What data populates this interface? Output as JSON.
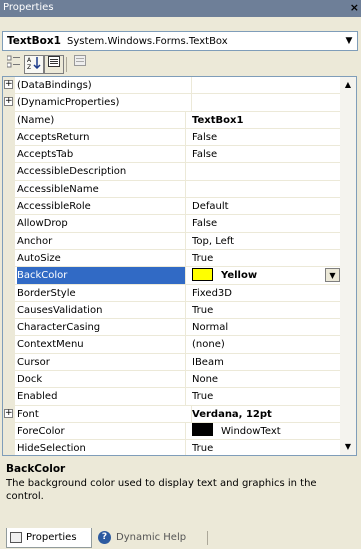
{
  "window": {
    "title": "Properties",
    "close_label": "×"
  },
  "object_selector": {
    "name": "TextBox1",
    "type": "System.Windows.Forms.TextBox"
  },
  "toolbar": {
    "categorized_icon": "categorized-icon",
    "alphabetical_icon": "alphabetical-icon",
    "properties_icon": "properties-icon",
    "property_pages_icon": "property-pages-icon"
  },
  "properties": [
    {
      "name": "(DataBindings)",
      "value": "",
      "expandable": true
    },
    {
      "name": "(DynamicProperties)",
      "value": "",
      "expandable": true
    },
    {
      "name": "(Name)",
      "value": "TextBox1",
      "bold": true
    },
    {
      "name": "AcceptsReturn",
      "value": "False"
    },
    {
      "name": "AcceptsTab",
      "value": "False"
    },
    {
      "name": "AccessibleDescription",
      "value": ""
    },
    {
      "name": "AccessibleName",
      "value": ""
    },
    {
      "name": "AccessibleRole",
      "value": "Default"
    },
    {
      "name": "AllowDrop",
      "value": "False"
    },
    {
      "name": "Anchor",
      "value": "Top, Left"
    },
    {
      "name": "AutoSize",
      "value": "True"
    },
    {
      "name": "BackColor",
      "value": "Yellow",
      "swatch": "#ffff00",
      "selected": true,
      "bold": true
    },
    {
      "name": "BorderStyle",
      "value": "Fixed3D"
    },
    {
      "name": "CausesValidation",
      "value": "True"
    },
    {
      "name": "CharacterCasing",
      "value": "Normal"
    },
    {
      "name": "ContextMenu",
      "value": "(none)"
    },
    {
      "name": "Cursor",
      "value": "IBeam"
    },
    {
      "name": "Dock",
      "value": "None"
    },
    {
      "name": "Enabled",
      "value": "True"
    },
    {
      "name": "Font",
      "value": "Verdana, 12pt",
      "expandable": true,
      "bold": true
    },
    {
      "name": "ForeColor",
      "value": "WindowText",
      "swatch": "#000000"
    },
    {
      "name": "HideSelection",
      "value": "True"
    }
  ],
  "description": {
    "title": "BackColor",
    "text": "The background color used to display text and graphics in the control."
  },
  "tabs": [
    {
      "label": "Properties",
      "active": true,
      "icon": "properties-icon"
    },
    {
      "label": "Dynamic Help",
      "active": false,
      "icon": "help-icon"
    }
  ],
  "colors": {
    "titlebar": "#6e7f98",
    "selection": "#316ac5",
    "panel": "#ece9d8"
  }
}
